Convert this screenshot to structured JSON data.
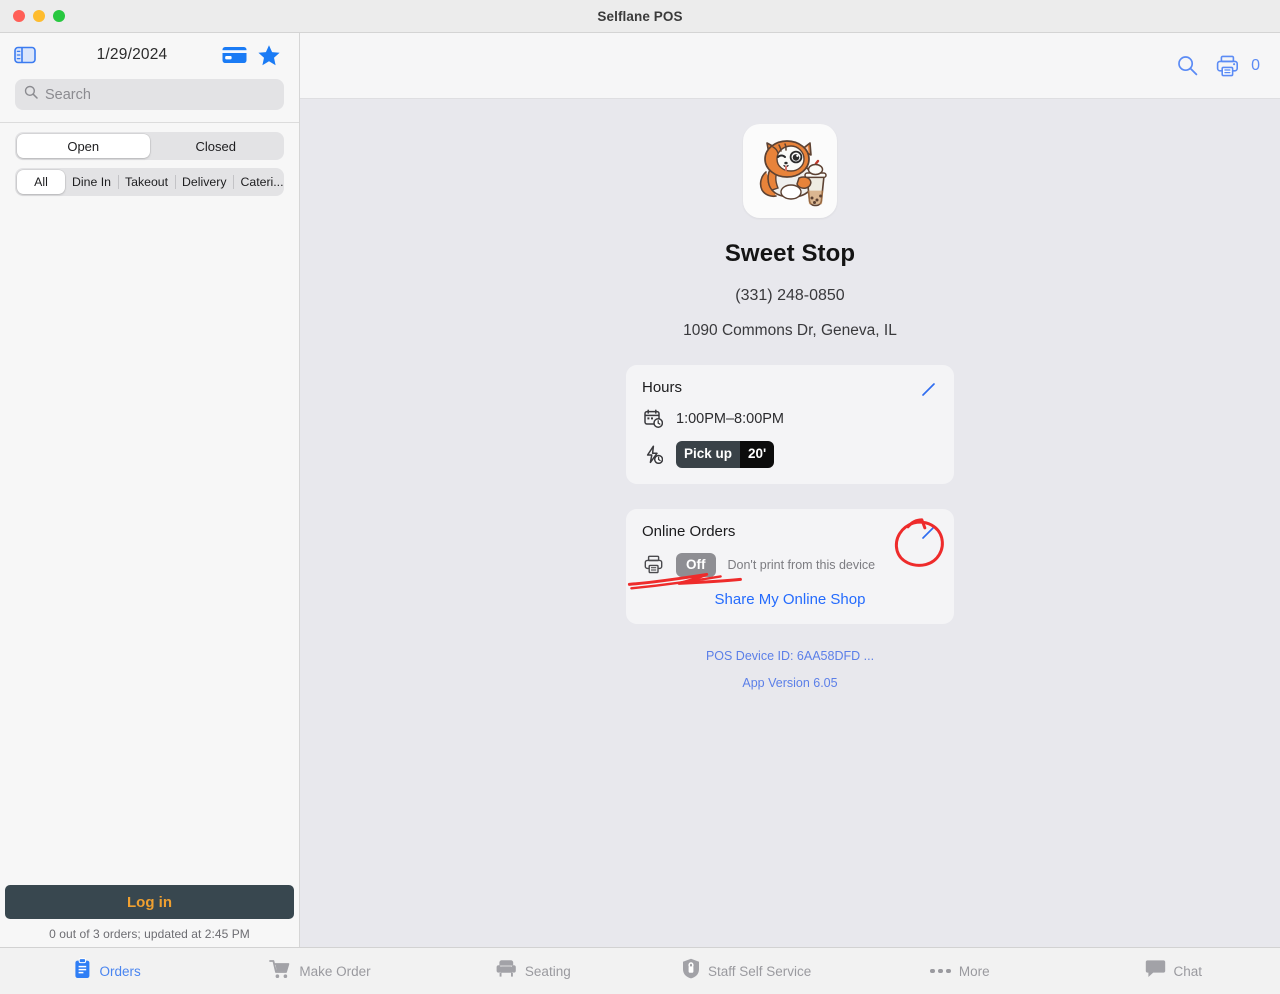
{
  "window": {
    "title": "Selflane POS",
    "traffic_lights": [
      "close",
      "minimize",
      "zoom"
    ]
  },
  "sidebar": {
    "toggle_icon": "sidebar-toggle-icon",
    "date": "1/29/2024",
    "card_icon": "credit-card-icon",
    "star_icon": "star-icon",
    "search": {
      "placeholder": "Search",
      "value": "",
      "icon": "search-icon"
    },
    "status_tabs": [
      {
        "label": "Open",
        "selected": true
      },
      {
        "label": "Closed",
        "selected": false
      }
    ],
    "type_tabs": [
      {
        "label": "All",
        "selected": true
      },
      {
        "label": "Dine In",
        "selected": false
      },
      {
        "label": "Takeout",
        "selected": false
      },
      {
        "label": "Delivery",
        "selected": false
      },
      {
        "label": "Cateri...",
        "selected": false
      }
    ],
    "login_button": "Log in",
    "status_text": "0 out of 3 orders; updated at 2:45 PM"
  },
  "toolbar": {
    "search_icon": "search-icon",
    "printer_icon": "printer-icon",
    "print_count": "0"
  },
  "store": {
    "logo_icon": "cat-bubble-tea-logo",
    "name": "Sweet Stop",
    "phone": "(331) 248-0850",
    "address": "1090 Commons Dr, Geneva, IL"
  },
  "hours_card": {
    "title": "Hours",
    "edit_icon": "pencil-edit-icon",
    "calendar_icon": "calendar-clock-icon",
    "hours_text": "1:00PM–8:00PM",
    "bolt_icon": "bolt-clock-icon",
    "chip_label": "Pick up",
    "chip_value": "20'"
  },
  "online_orders_card": {
    "title": "Online Orders",
    "edit_icon": "pencil-edit-icon",
    "printer_icon": "printer-icon",
    "toggle_label": "Off",
    "toggle_note": "Don't print from this device",
    "share_link": "Share My Online Shop"
  },
  "footer_links": [
    "POS Device ID: 6AA58DFD ...",
    "App Version 6.05"
  ],
  "tabbar": [
    {
      "label": "Orders",
      "icon": "clipboard-icon",
      "active": true
    },
    {
      "label": "Make Order",
      "icon": "cart-icon",
      "active": false
    },
    {
      "label": "Seating",
      "icon": "armchair-icon",
      "active": false
    },
    {
      "label": "Staff Self Service",
      "icon": "shield-lock-icon",
      "active": false
    },
    {
      "label": "More",
      "icon": "ellipsis-icon",
      "active": false
    },
    {
      "label": "Chat",
      "icon": "chat-bubble-icon",
      "active": false
    }
  ],
  "annotations": {
    "circle": "red-circle-around-edit-icon",
    "underline": "red-underline-under-off-toggle",
    "color": "#ee2b2b"
  },
  "colors": {
    "accent_blue": "#246bfd",
    "tab_blue": "#4a85f0",
    "login_bg": "#38474f",
    "login_text": "#f0a030",
    "main_bg": "#e8e8ed",
    "card_bg": "#f4f4f6",
    "annotation_red": "#ee2b2b"
  }
}
